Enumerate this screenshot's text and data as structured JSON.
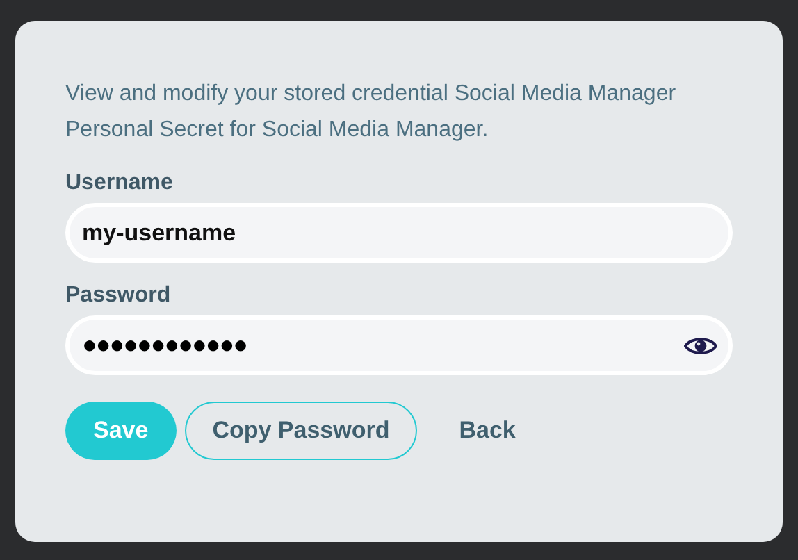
{
  "dialog": {
    "description": "View and modify your stored credential Social Media Manager Personal Secret for Social Media Manager.",
    "fields": [
      {
        "label": "Username",
        "value": "my-username",
        "kind": "text"
      },
      {
        "label": "Password",
        "value": "●●●●●●●●●●●●",
        "kind": "secret"
      }
    ],
    "buttons": [
      {
        "label": "Save",
        "kind": "primary"
      },
      {
        "label": "Copy Password",
        "kind": "outline"
      },
      {
        "label": "Back",
        "kind": "link"
      }
    ]
  }
}
